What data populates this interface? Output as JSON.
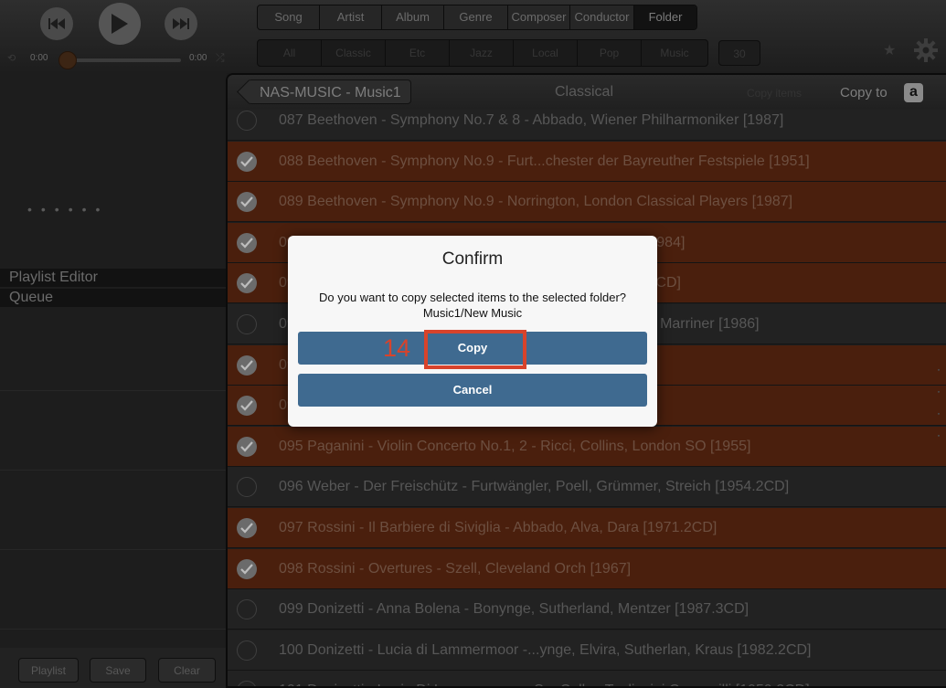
{
  "player": {
    "time_current": "0:00",
    "time_total": "0:00",
    "progress_fraction": 0.0
  },
  "tabs": {
    "categories": [
      "Song",
      "Artist",
      "Album",
      "Genre",
      "Composer",
      "Conductor",
      "Folder"
    ],
    "active_category": "Folder",
    "genres": [
      "All",
      "Classic",
      "Etc",
      "Jazz",
      "Local",
      "Pop",
      "Music"
    ],
    "count_badge": "30"
  },
  "left": {
    "playlist_editor": "Playlist Editor",
    "queue": "Queue",
    "buttons": {
      "playlist": "Playlist",
      "save": "Save",
      "clear": "Clear"
    }
  },
  "navbar": {
    "back_label": "NAS-MUSIC - Music1",
    "title": "Classical",
    "copy_items": "Copy items",
    "copy_to": "Copy to",
    "a_icon_glyph": "a"
  },
  "rows": [
    {
      "text": "087 Beethoven - Symphony No.7 & 8 - Abbado, Wiener Philharmoniker [1987]",
      "selected": false
    },
    {
      "text": "088 Beethoven - Symphony No.9 - Furt...chester der Bayreuther Festspiele [1951]",
      "selected": true
    },
    {
      "text": "089 Beethoven - Symphony No.9 - Norrington, London Classical Players [1987]",
      "selected": true
    },
    {
      "text": "090 Beethoven - Violin Concerto - Mutter, Karajan, BPO [1984]",
      "selected": true
    },
    {
      "text": "091 Beethoven - Violin Sonatas - Oistrakh, Oborin [1962.4CD]",
      "selected": true
    },
    {
      "text": "092 Haydn, Hummel - Trumpet Concertos - Hardenberger, Marriner [1986]",
      "selected": false
    },
    {
      "text": "093 Mozart - Clarinet Concerto - Kell [1958]",
      "selected": true
    },
    {
      "text": "094 Mozart - Requiem - Kertesz [1959]",
      "selected": true
    },
    {
      "text": "095 Paganini - Violin Concerto No.1, 2 - Ricci, Collins, London SO [1955]",
      "selected": true
    },
    {
      "text": "096 Weber - Der Freischütz - Furtwängler, Poell, Grümmer, Streich [1954.2CD]",
      "selected": false
    },
    {
      "text": "097 Rossini - Il Barbiere di Siviglia - Abbado, Alva, Dara [1971.2CD]",
      "selected": true
    },
    {
      "text": "098 Rossini - Overtures - Szell, Cleveland Orch [1967]",
      "selected": true
    },
    {
      "text": "099 Donizetti - Anna Bolena - Bonynge, Sutherland, Mentzer [1987.3CD]",
      "selected": false
    },
    {
      "text": "100 Donizetti - Lucia di Lammermoor -...ynge, Elvira, Sutherlan, Kraus [1982.2CD]",
      "selected": false
    },
    {
      "text": "101 Donizetti - Lucia Di Lammermoor - S... Callas,Tagliavini,Capuccilli [1959.2CD]",
      "selected": false
    }
  ],
  "dialog": {
    "title": "Confirm",
    "message": "Do you want to copy selected items to the selected folder?",
    "target": "Music1/New Music",
    "copy_label": "Copy",
    "cancel_label": "Cancel"
  },
  "annotation": {
    "step_number": "14",
    "color": "#d8432b"
  }
}
